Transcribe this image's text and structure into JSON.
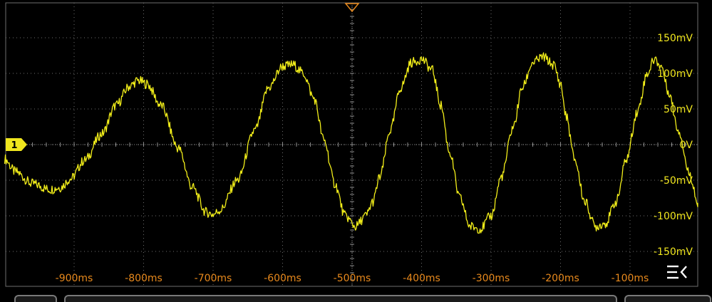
{
  "colors": {
    "trace": "#f2ee1a",
    "x_labels": "#e8891c",
    "y_labels": "#f0e61e",
    "grid": "#6e6e6e",
    "background": "#000000",
    "trigger_marker": "#e8891c"
  },
  "channel_marker": {
    "label": "1"
  },
  "menu_icon": "collapse-menu-icon",
  "chart_data": {
    "type": "line",
    "title": "",
    "xlabel": "",
    "ylabel": "",
    "x_unit": "ms",
    "y_unit": "mV",
    "xlim": [
      -1000,
      0
    ],
    "ylim": [
      -200,
      200
    ],
    "grid": true,
    "x_ticks": [
      -900,
      -800,
      -700,
      -600,
      -500,
      -400,
      -300,
      -200,
      -100
    ],
    "x_tick_labels": [
      "-900ms",
      "-800ms",
      "-700ms",
      "-600ms",
      "-500ms",
      "-400ms",
      "-300ms",
      "-200ms",
      "-100ms"
    ],
    "y_ticks": [
      150,
      100,
      50,
      0,
      -50,
      -100,
      -150
    ],
    "y_tick_labels": [
      "150mV",
      "100mV",
      "50mV",
      "0V",
      "-50mV",
      "-100mV",
      "-150mV"
    ],
    "trigger_time": -500,
    "series": [
      {
        "x": [
          -1000,
          -985,
          -960,
          -935,
          -920,
          -905,
          -885,
          -860,
          -840,
          -820,
          -808,
          -795,
          -775,
          -750,
          -730,
          -710,
          -700,
          -690,
          -665,
          -640,
          -620,
          -600,
          -585,
          -570,
          -555,
          -540,
          -525,
          -510,
          -495,
          -480,
          -470,
          -460,
          -445,
          -430,
          -415,
          -400,
          -385,
          -372,
          -360,
          -345,
          -330,
          -315,
          -300,
          -285,
          -268,
          -255,
          -240,
          -225,
          -210,
          -200,
          -192,
          -180,
          -165,
          -150,
          -135,
          -120,
          -105,
          -90,
          -75,
          -65,
          -55,
          -45,
          -30,
          -15,
          0
        ],
        "y": [
          -20,
          -38,
          -55,
          -63,
          -60,
          -48,
          -22,
          15,
          55,
          82,
          90,
          85,
          55,
          -5,
          -60,
          -95,
          -98,
          -92,
          -50,
          20,
          80,
          110,
          112,
          100,
          65,
          5,
          -55,
          -100,
          -115,
          -100,
          -80,
          -45,
          20,
          80,
          115,
          120,
          105,
          55,
          -10,
          -75,
          -115,
          -118,
          -100,
          -45,
          25,
          80,
          115,
          123,
          112,
          85,
          40,
          -20,
          -80,
          -115,
          -110,
          -80,
          -20,
          45,
          100,
          120,
          110,
          75,
          20,
          -40,
          -90
        ]
      }
    ]
  }
}
